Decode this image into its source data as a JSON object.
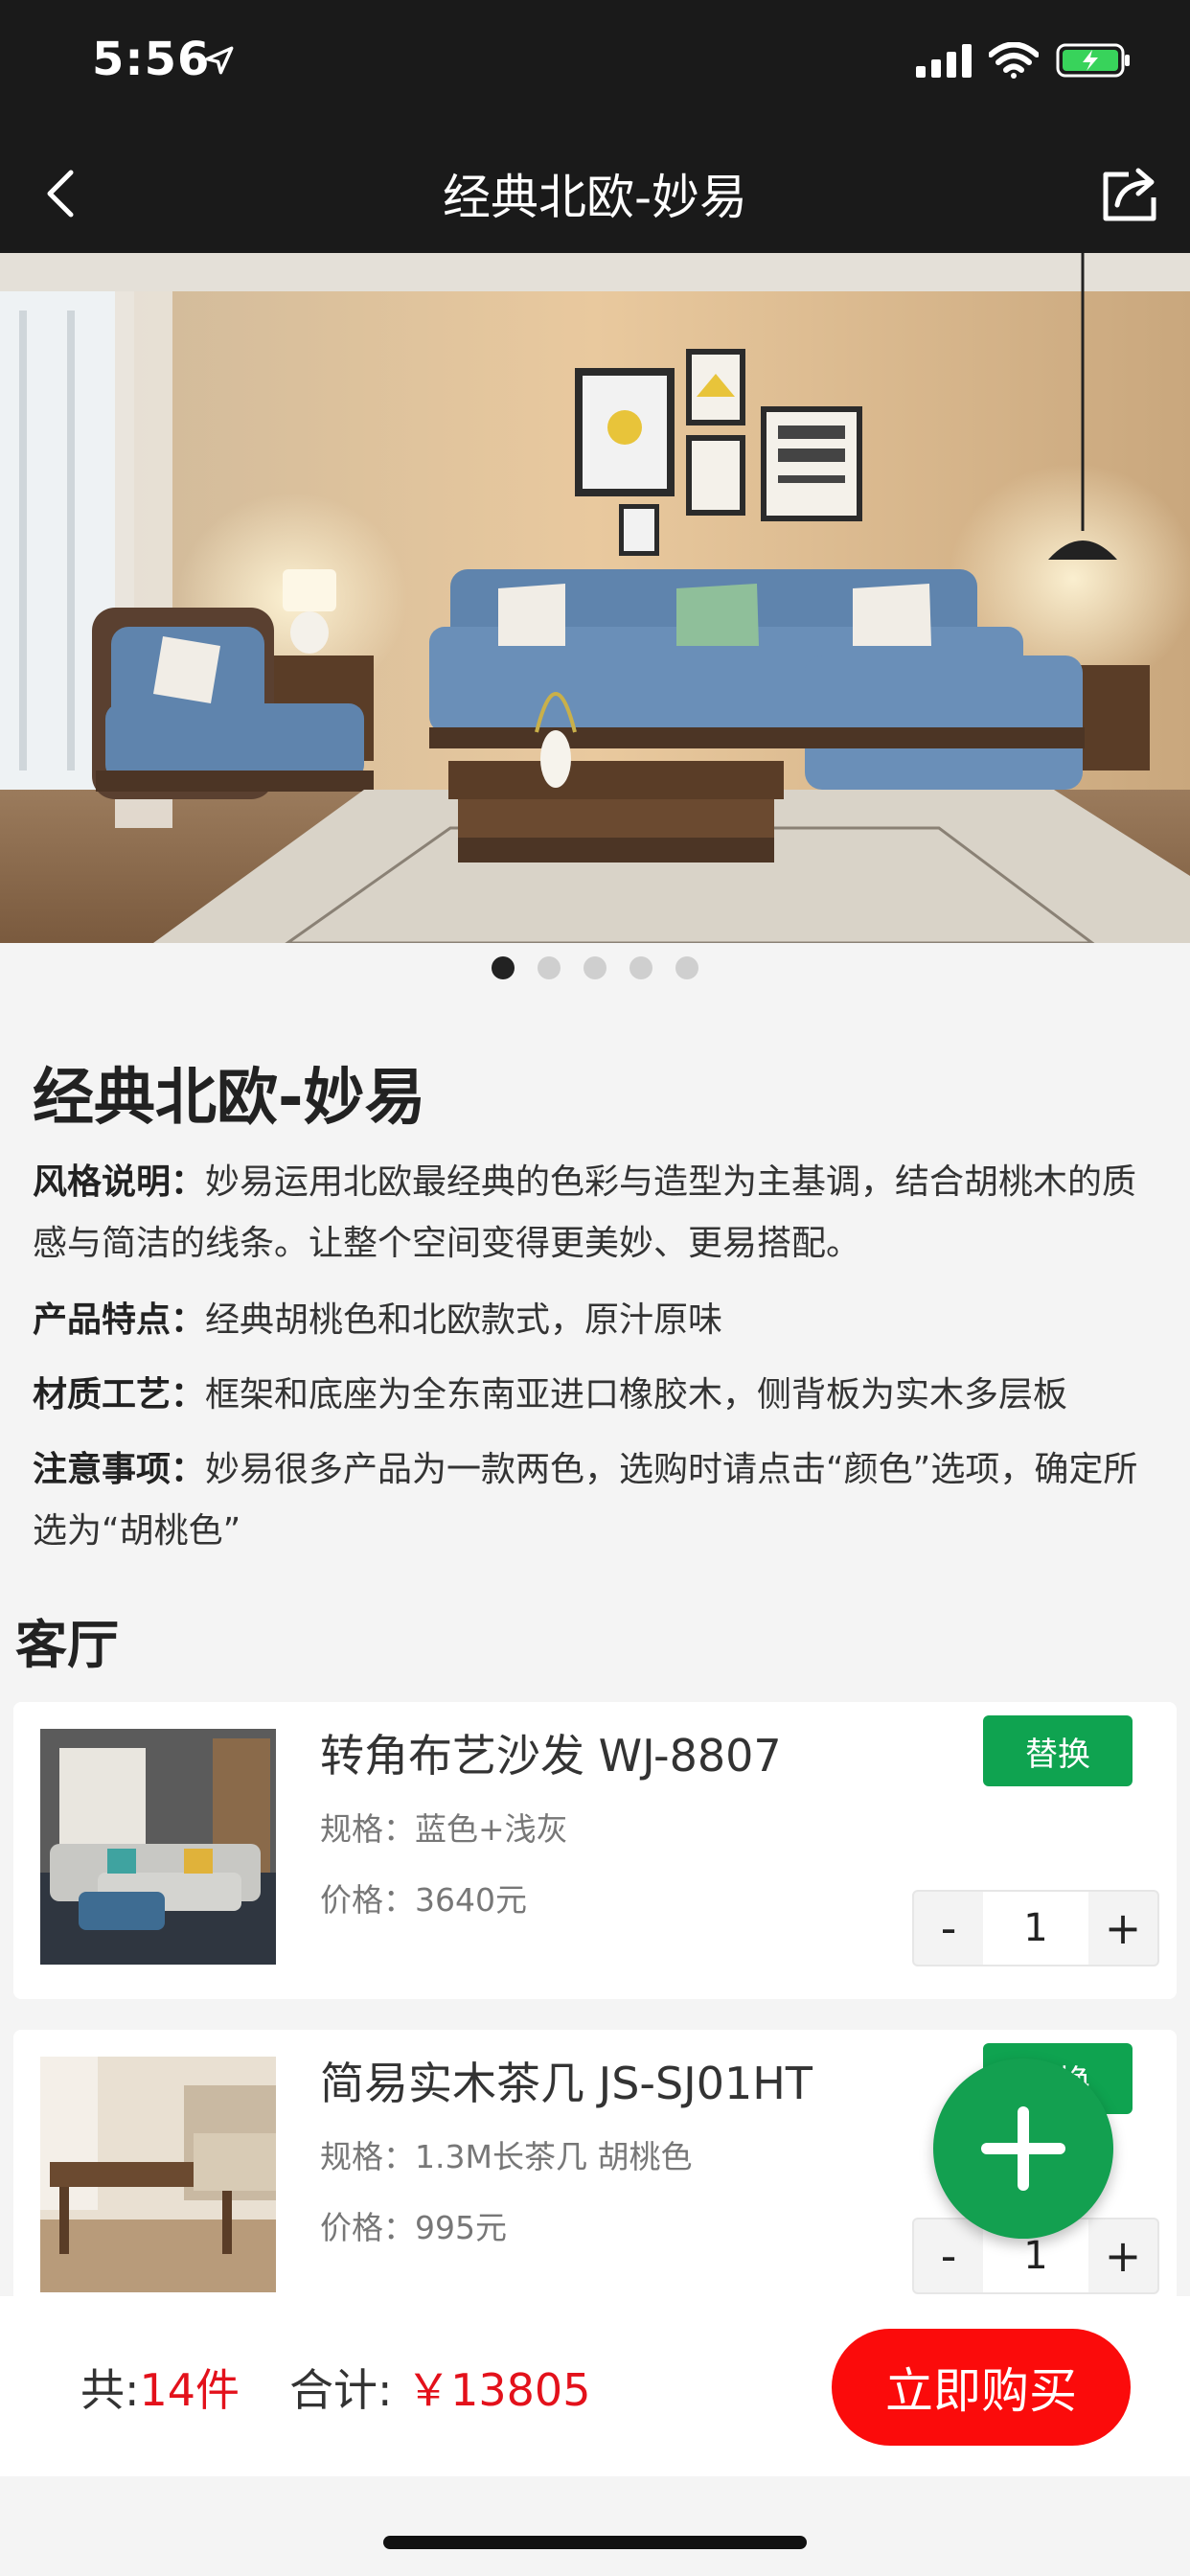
{
  "status": {
    "time": "5:56"
  },
  "nav": {
    "title": "经典北欧-妙易"
  },
  "gallery": {
    "count": 5,
    "active": 0
  },
  "product": {
    "title": "经典北欧-妙易",
    "style_label": "风格说明：",
    "style_text": "妙易运用北欧最经典的色彩与造型为主基调，结合胡桃木的质感与简洁的线条。让整个空间变得更美妙、更易搭配。",
    "feature_label": "产品特点：",
    "feature_text": "经典胡桃色和北欧款式，原汁原味",
    "material_label": "材质工艺：",
    "material_text": "框架和底座为全东南亚进口橡胶木，侧背板为实木多层板",
    "notice_label": "注意事项：",
    "notice_text": "妙易很多产品为一款两色，选购时请点击“颜色”选项，确定所选为“胡桃色”"
  },
  "section": {
    "title": "客厅"
  },
  "items": [
    {
      "name": "转角布艺沙发 WJ-8807",
      "spec": "规格：蓝色+浅灰",
      "price": "价格：3640元",
      "replace": "替换",
      "qty": "1",
      "minus": "-",
      "plus": "+"
    },
    {
      "name": "简易实木茶几 JS-SJ01HT",
      "spec": "规格：1.3M长茶几 胡桃色",
      "price": "价格：995元",
      "replace": "替换",
      "qty": "1",
      "minus": "-",
      "plus": "+"
    }
  ],
  "footer": {
    "count_label": "共:",
    "count_value": "14件",
    "total_label": "合计:",
    "total_value": "￥13805",
    "buy": "立即购买"
  },
  "colors": {
    "green": "#0fa350",
    "red": "#fb0b0b",
    "dark": "#1a1a1a"
  }
}
